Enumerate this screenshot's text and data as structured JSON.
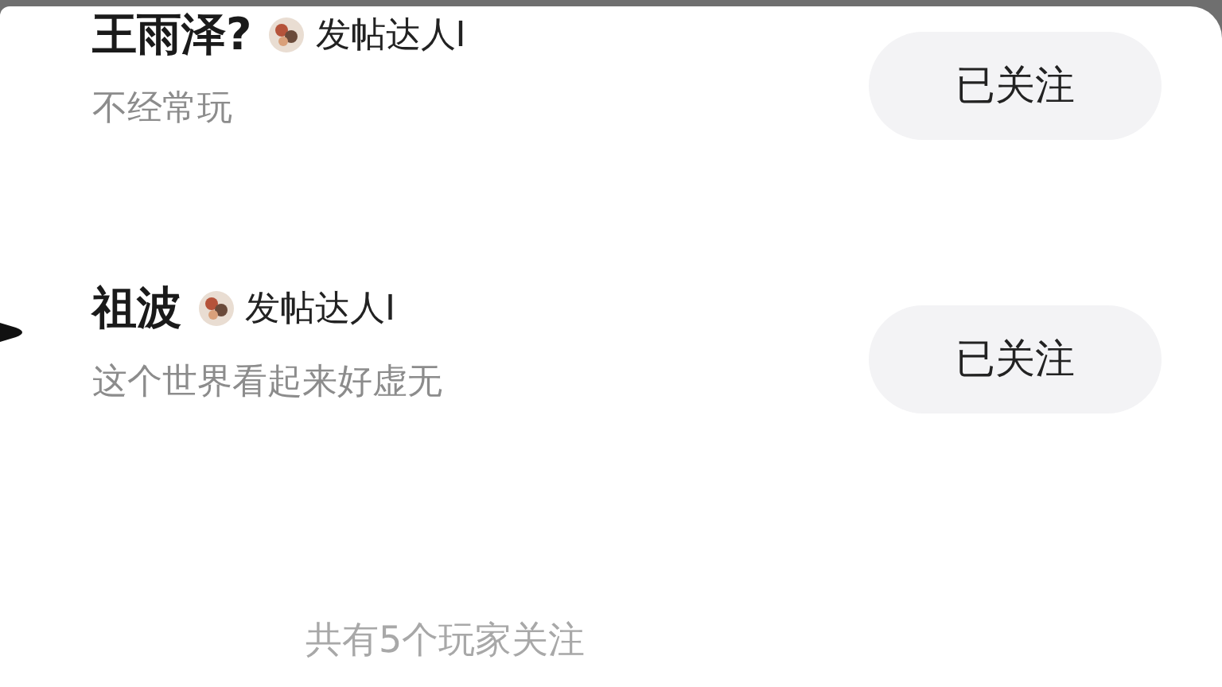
{
  "followers": [
    {
      "name": "王雨泽?",
      "badge": "发帖达人I",
      "bio": "不经常玩",
      "button": "已关注"
    },
    {
      "name": "祖波",
      "badge": "发帖达人I",
      "bio": "这个世界看起来好虚无",
      "button": "已关注"
    }
  ],
  "footer": "共有5个玩家关注"
}
